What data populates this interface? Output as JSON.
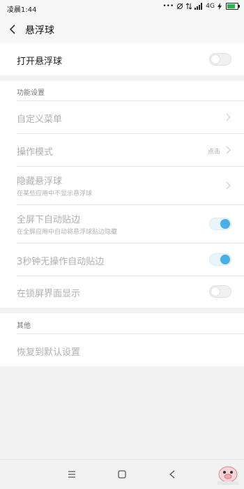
{
  "status_bar": {
    "time": "凌晨1:44",
    "signal_text": "4G",
    "battery_level": 0.75
  },
  "header": {
    "title": "悬浮球",
    "back_icon": "chevron-left-icon"
  },
  "main_toggle": {
    "label": "打开悬浮球",
    "on": false
  },
  "sections": {
    "function": {
      "title": "功能设置",
      "items": [
        {
          "label": "自定义菜单"
        },
        {
          "label": "操作模式",
          "value": "点击"
        },
        {
          "label": "隐藏悬浮球",
          "sub": "在某些应用中不显示悬浮球"
        },
        {
          "label": "全屏下自动贴边",
          "sub": "在全屏应用中自动将悬浮球贴边隐藏",
          "on": true
        },
        {
          "label": "3秒钟无操作自动贴边",
          "on": true
        },
        {
          "label": "在锁屏界面显示",
          "on": false
        }
      ]
    },
    "other": {
      "title": "其他",
      "items": [
        {
          "label": "恢复到默认设置"
        }
      ]
    }
  },
  "colors": {
    "accent": "#4aaee8",
    "disabled_text": "#b0b0b0",
    "background": "#f2f2f2"
  },
  "nav_icons": [
    "menu-icon",
    "home-square-icon",
    "back-triangle-icon"
  ]
}
